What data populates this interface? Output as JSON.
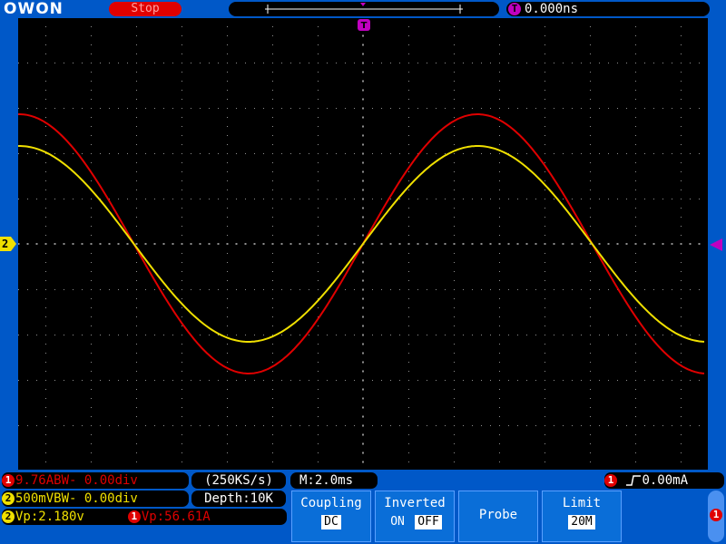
{
  "header": {
    "logo": "OWON",
    "status": "Stop",
    "trigger_marker": "T",
    "trigger_time": "0.000ns"
  },
  "channels": {
    "ch1": {
      "id": "1",
      "scale": "9.76ABW- 0.00div",
      "vp": "Vp:56.61A",
      "color": "#e00000"
    },
    "ch2": {
      "id": "2",
      "scale": "500mVBW- 0.00div",
      "vp": "Vp:2.180v",
      "color": "#f0e000"
    }
  },
  "acquisition": {
    "sample_rate": "(250KS/s)",
    "depth": "Depth:10K",
    "timebase": "M:2.0ms"
  },
  "trigger": {
    "channel": "1",
    "edge_icon": "rising-edge-icon",
    "level": "0.00mA"
  },
  "menu": {
    "coupling": {
      "label": "Coupling",
      "value": "DC"
    },
    "inverted": {
      "label": "Inverted",
      "on": "ON",
      "off": "OFF",
      "selected": "OFF"
    },
    "probe": {
      "label": "Probe"
    },
    "limit": {
      "label": "Limit",
      "value": "20M"
    }
  },
  "side_indicator": "1",
  "ch2_ground_marker": "2",
  "colors": {
    "background": "#0058c8",
    "screen": "#000000",
    "ch1": "#e00000",
    "ch2": "#f0e000",
    "trigger": "#c000c0",
    "grid": "#808080"
  }
}
